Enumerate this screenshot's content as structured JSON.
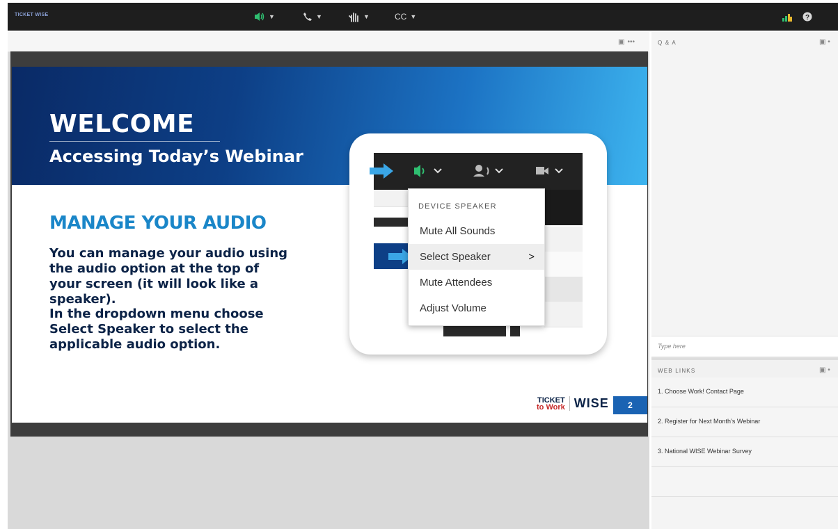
{
  "topbar": {
    "logo": "TICKET WISE",
    "audio": "audio",
    "phone": "phone",
    "raise_hand": "raise-hand",
    "cc_label": "CC",
    "right_icons": [
      "signal-icon",
      "help-icon"
    ]
  },
  "stage": {
    "header_menu": "•••"
  },
  "slide": {
    "welcome": "WELCOME",
    "subtitle": "Accessing Today’s Webinar",
    "heading": "MANAGE YOUR AUDIO",
    "para1": "You can manage your audio using the audio option at the top of your screen (it will look like a speaker).",
    "para2_prefix": "In the dropdown menu choose ",
    "para2_bold": "Select Speaker",
    "para2_suffix": " to select the applicable audio option.",
    "menu_header": "DEVICE SPEAKER",
    "menu_items": [
      "Mute All Sounds",
      "Select Speaker",
      "Mute Attendees",
      "Adjust Volume"
    ],
    "logo_ticket": "TICKET",
    "logo_towork": "to Work",
    "logo_wise": "WISE",
    "page_number": "2"
  },
  "qa": {
    "title": "Q & A",
    "placeholder": "Type here"
  },
  "weblinks": {
    "title": "WEB LINKS",
    "items": [
      "1. Choose Work! Contact Page",
      "2. Register for Next Month’s Webinar",
      "3. National WISE Webinar Survey"
    ]
  },
  "colors": {
    "topbar": "#1e1e1e",
    "accent_green": "#2fbf71",
    "slide_blue": "#0d3f86",
    "heading_blue": "#1a86c8"
  }
}
